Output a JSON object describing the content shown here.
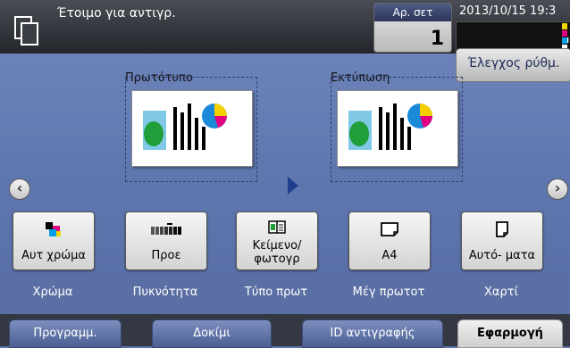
{
  "status": {
    "text": "Έτοιμο για αντιγρ."
  },
  "sets": {
    "label": "Αρ. σετ",
    "value": "1"
  },
  "datetime": "2013/10/15 19:3",
  "toner": [
    {
      "letter": "Y",
      "color": "#f2d600"
    },
    {
      "letter": "M",
      "color": "#e4007f"
    },
    {
      "letter": "C",
      "color": "#00a0e9"
    },
    {
      "letter": "K",
      "color": "#ffffff"
    }
  ],
  "check_tab": "Έλεγχος ρύθμ.",
  "preview": {
    "original_label": "Πρωτότυπο",
    "output_label": "Εκτύπωση"
  },
  "functions": [
    {
      "label": "Αυτ χρώμα",
      "caption": "Χρώμα",
      "icon": "color-icon"
    },
    {
      "label": "Προε",
      "caption": "Πυκνότητα",
      "icon": "density-icon"
    },
    {
      "label": "Κείμενο/ φωτογρ",
      "caption": "Τύπο πρωτ",
      "icon": "original-type-icon"
    },
    {
      "label": "A4",
      "caption": "Μέγ πρωτοτ",
      "icon": "original-size-icon"
    },
    {
      "label": "Αυτό- ματα",
      "caption": "Χαρτί",
      "icon": "paper-icon"
    }
  ],
  "bottom_tabs": [
    {
      "label": "Προγραμμ.",
      "active": false
    },
    {
      "label": "Δοκίμι",
      "active": false
    },
    {
      "label": "ID αντιγραφής",
      "active": false
    },
    {
      "label": "Εφαρμογή",
      "active": true
    }
  ],
  "colors": {
    "accent": "#1f3f90",
    "background": "#5e76ae",
    "topbar": "#2a2d33"
  }
}
